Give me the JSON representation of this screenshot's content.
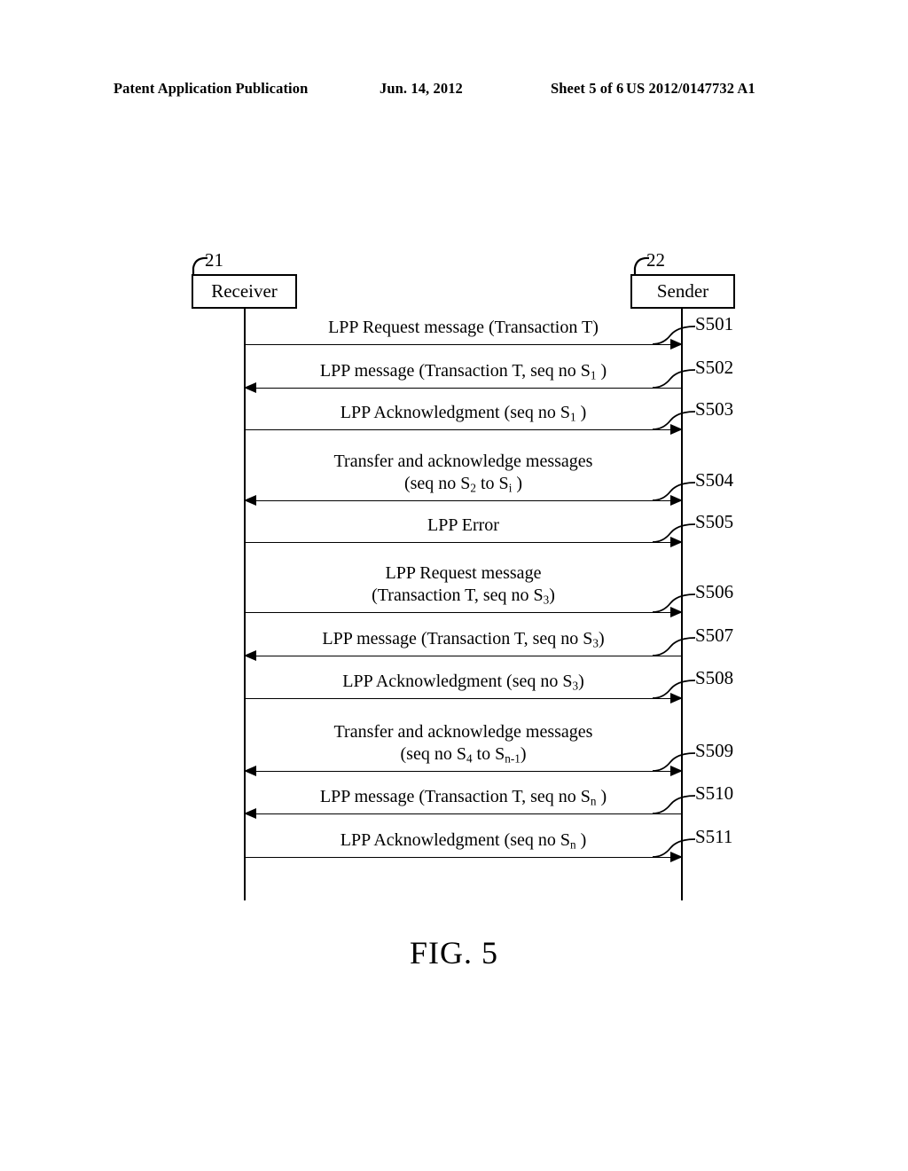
{
  "header": {
    "publication": "Patent Application Publication",
    "date": "Jun. 14, 2012",
    "sheet": "Sheet 5 of 6",
    "patent_number": "US 2012/0147732 A1"
  },
  "figure": {
    "caption": "FIG.  5",
    "type": "sequence-diagram"
  },
  "entities": [
    {
      "id": "receiver",
      "label": "Receiver",
      "ref": "21"
    },
    {
      "id": "sender",
      "label": "Sender",
      "ref": "22"
    }
  ],
  "messages": [
    {
      "step": "S501",
      "direction": "right",
      "label_html": "LPP Request message (Transaction T)",
      "lines": 1
    },
    {
      "step": "S502",
      "direction": "left",
      "label_html": "LPP message (Transaction T, seq no S<sub>1</sub> )",
      "lines": 1
    },
    {
      "step": "S503",
      "direction": "right",
      "label_html": "LPP Acknowledgment (seq no S<sub>1</sub> )",
      "lines": 1
    },
    {
      "step": "S504",
      "direction": "both",
      "label_html": "Transfer and acknowledge messages<br>(seq no S<sub>2</sub> to S<sub>i</sub> )",
      "lines": 2
    },
    {
      "step": "S505",
      "direction": "right",
      "label_html": "LPP Error",
      "lines": 1
    },
    {
      "step": "S506",
      "direction": "right",
      "label_html": "LPP Request message<br>(Transaction T, seq no S<sub>3</sub>)",
      "lines": 2
    },
    {
      "step": "S507",
      "direction": "left",
      "label_html": "LPP message (Transaction T, seq no S<sub>3</sub>)",
      "lines": 1
    },
    {
      "step": "S508",
      "direction": "right",
      "label_html": "LPP Acknowledgment (seq no S<sub>3</sub>)",
      "lines": 1
    },
    {
      "step": "S509",
      "direction": "both",
      "label_html": "Transfer and acknowledge messages<br>(seq no S<sub>4</sub> to S<sub>n-1</sub>)",
      "lines": 2
    },
    {
      "step": "S510",
      "direction": "left",
      "label_html": "LPP message (Transaction T, seq no S<sub>n</sub> )",
      "lines": 1
    },
    {
      "step": "S511",
      "direction": "right",
      "label_html": "LPP Acknowledgment (seq no S<sub>n</sub> )",
      "lines": 1
    }
  ],
  "geometry": {
    "message_y": [
      388,
      437,
      484,
      564,
      611,
      690,
      739,
      787,
      869,
      917,
      966
    ]
  }
}
